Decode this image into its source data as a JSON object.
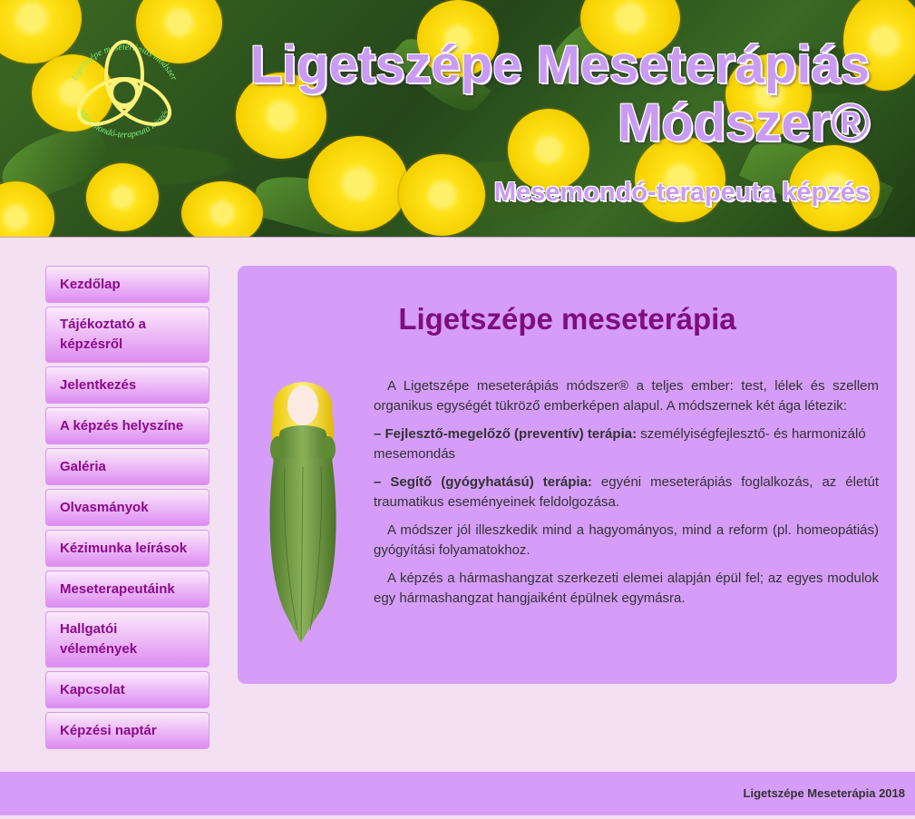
{
  "header": {
    "title_line1": "Ligetszépe Meseterápiás",
    "title_line2": "Módszer®",
    "subtitle": "Mesemondó-terapeuta képzés",
    "logo_text_top": "Ligetszépe meseterápiás módszer",
    "logo_text_bottom": "Mesemondó-terapeuta képzés",
    "logo_icon": "trefoil-knot-icon"
  },
  "nav": {
    "items": [
      {
        "label": "Kezdőlap"
      },
      {
        "label": "Tájékoztató a képzésről"
      },
      {
        "label": "Jelentkezés"
      },
      {
        "label": "A képzés helyszíne"
      },
      {
        "label": "Galéria"
      },
      {
        "label": "Olvasmányok"
      },
      {
        "label": "Kézimunka leírások"
      },
      {
        "label": "Meseterapeutáink"
      },
      {
        "label": "Hallgatói vélemények"
      },
      {
        "label": "Kapcsolat"
      },
      {
        "label": "Képzési naptár"
      }
    ]
  },
  "content": {
    "title": "Ligetszépe meseterápia",
    "paragraphs": {
      "p1": "A Ligetszépe meseterápiás módszer® a teljes ember: test, lélek és szellem organikus egységét tükröző emberképen alapul. A módszernek két ága létezik:",
      "p2_bold": "– Fejlesztő-megelőző (preventív) terápia:",
      "p2_text": " személyiségfejlesztő- és harmonizáló mesemondás",
      "p3_bold": "– Segítő (gyógyhatású) terápia:",
      "p3_text": " egyéni meseterápiás foglalkozás, az életút traumatikus eseményeinek feldolgozása.",
      "p4": "A módszer jól illeszkedik mind a hagyományos, mind a reform (pl. homeopátiás) gyógyítási folyamatokhoz.",
      "p5": "A képzés a hármashangzat szerkezeti elemei alapján épül fel; az egyes modulok egy hármashangzat hangjaiként épülnek egymásra."
    },
    "image_icon": "felt-fairy-doll-image"
  },
  "footer": {
    "text": "Ligetszépe Meseterápia 2018"
  },
  "colors": {
    "page_bg": "#f3e0f3",
    "panel_bg": "#d59df8",
    "title_color": "#7f0d7f",
    "nav_text": "#8b0a8b",
    "header_title": "#c99bf2"
  }
}
